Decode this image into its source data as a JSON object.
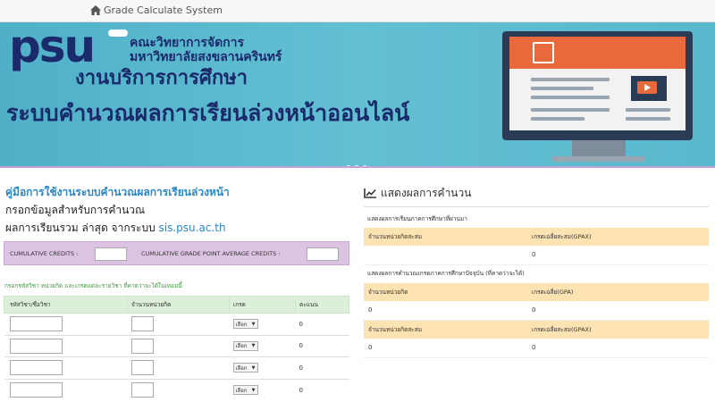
{
  "navbar": {
    "brand": "Grade Calculate System",
    "icon": "home-icon"
  },
  "banner": {
    "logo": "psu",
    "faculty_line1": "คณะวิทยาการจัดการ",
    "faculty_line2": "มหาวิทยาลัยสงขลานครินทร์",
    "service": "งานบริการการศึกษา",
    "title": "ระบบคำนวณผลการเรียนล่วงหน้าออนไลน์",
    "slides": 3,
    "active_slide": 1,
    "colors": {
      "background": "#5ab8cc",
      "text": "#1b2a6b",
      "accent": "#e86a3c"
    }
  },
  "left": {
    "manual_link": "คู่มือการใช้งานระบบคำนวณผลการเรียนล่วงหน้า",
    "fill_text": "กรอกข้อมูลสำหรับการคำนวณ",
    "latest_prefix": "ผลการเรียนรวม ล่าสุด จากระบบ ",
    "latest_link": "sis.psu.ac.th",
    "cumulative_credits_label": "CUMULATIVE CREDITS :",
    "cumulative_gpa_label": "CUMULATIVE GRADE POINT AVERAGE CREDITS :",
    "cumulative_credits_value": "",
    "cumulative_gpa_value": "",
    "instruction": "กรอกรหัสวิชา หน่วยกิต และเกรดแต่ละรายวิชา ที่คาดว่าจะได้ในเทอมนี้",
    "table": {
      "headers": [
        "รหัสวิชา/ชื่อวิชา",
        "จำนวนหน่วยกิต",
        "เกรด",
        "คะแนน"
      ],
      "rows": [
        {
          "code": "",
          "credits": "",
          "grade": "เลือก",
          "score": "0"
        },
        {
          "code": "",
          "credits": "",
          "grade": "เลือก",
          "score": "0"
        },
        {
          "code": "",
          "credits": "",
          "grade": "เลือก",
          "score": "0"
        },
        {
          "code": "",
          "credits": "",
          "grade": "เลือก",
          "score": "0"
        }
      ]
    }
  },
  "right": {
    "title": "แสดงผลการคำนวน",
    "section1_label": "แสดงผลการเรียนภาคการศึกษาที่ผ่านมา",
    "section2_label": "แสดงผลการคำนวณเกรดภาคการศึกษาปัจจุบัน (ที่คาดว่าจะได้)",
    "table1": {
      "h1": "จำนวนหน่วยกิตสะสม",
      "h2": "เกรดเฉลี่ยสะสม(GPAX)",
      "v1": "",
      "v2": "0"
    },
    "table2": {
      "h1": "จำนวนหน่วยกิต",
      "h2": "เกรดเฉลี่ย(GPA)",
      "v1": "0",
      "v2": "0"
    },
    "table3": {
      "h1": "จำนวนหน่วยกิตสะสม",
      "h2": "เกรดเฉลี่ยสะสม(GPAX)",
      "v1": "0",
      "v2": "0"
    }
  }
}
